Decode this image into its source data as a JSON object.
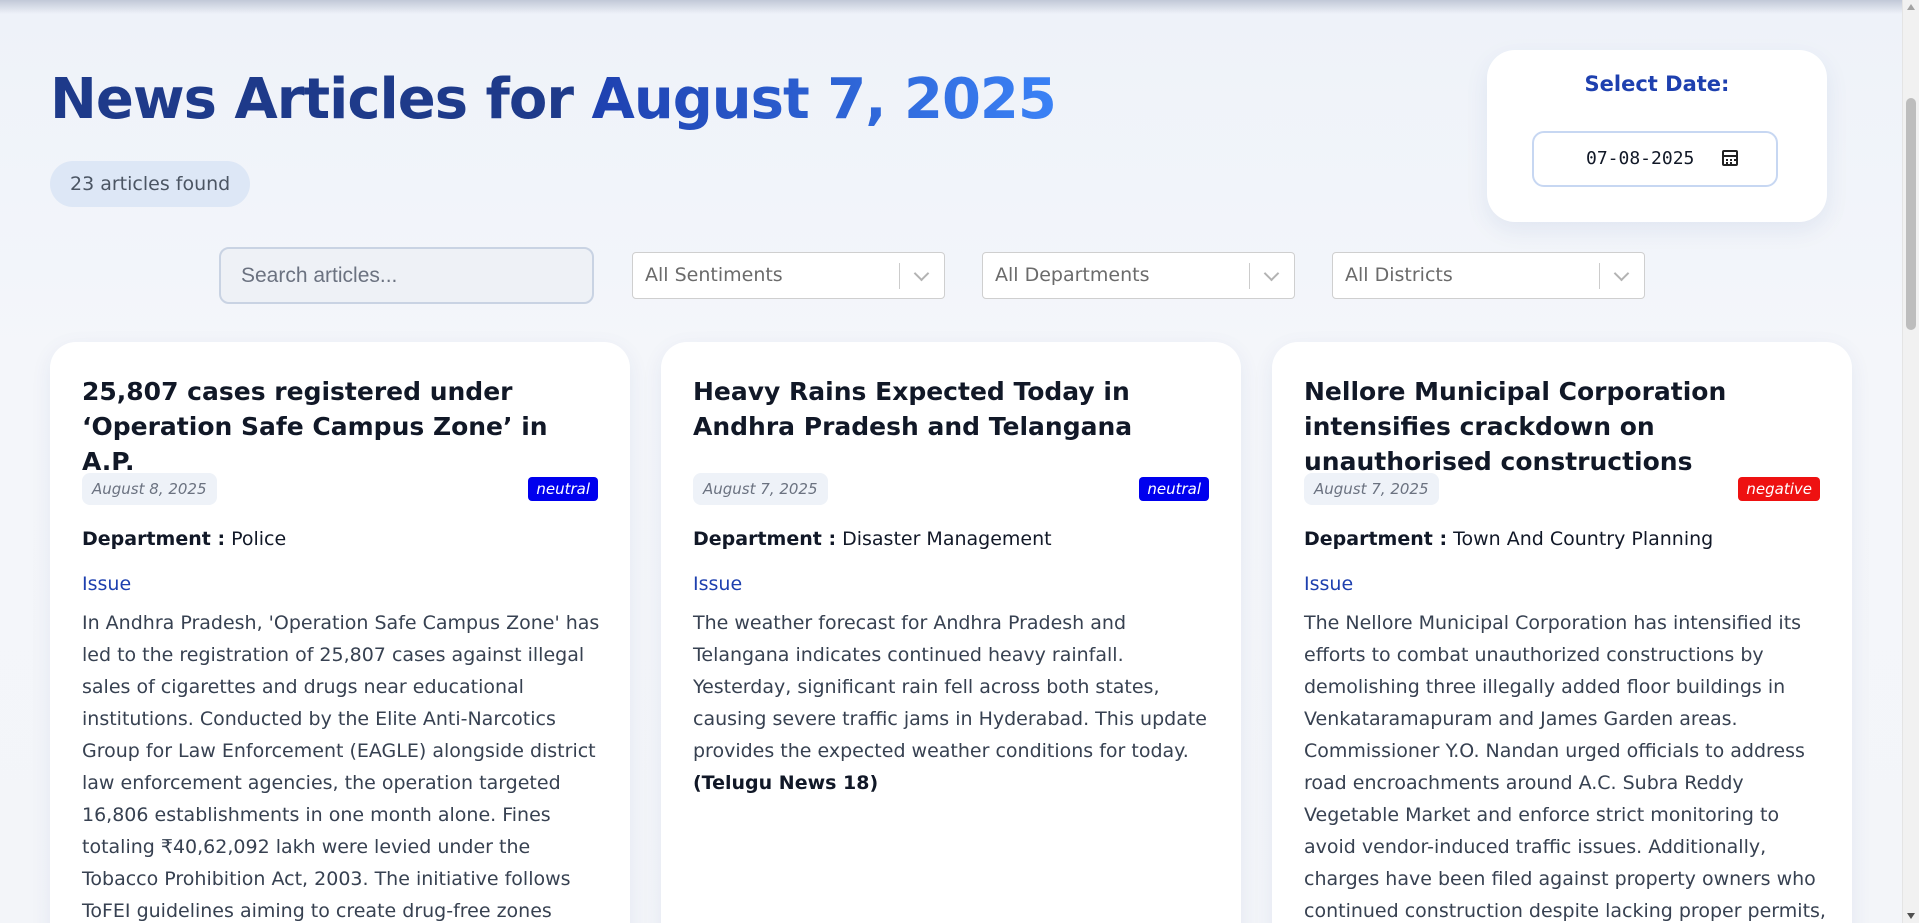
{
  "header": {
    "title_prefix": "News Articles for",
    "title_date": "August 7, 2025",
    "articles_found": "23 articles found"
  },
  "date_picker": {
    "label": "Select Date:",
    "value": "07-08-2025",
    "icon": "calendar-icon"
  },
  "filters": {
    "search_placeholder": "Search articles...",
    "sentiment_value": "All Sentiments",
    "department_value": "All Departments",
    "district_value": "All Districts"
  },
  "colors": {
    "title": "#1e3a8a",
    "accent": "#1e40af",
    "neutral_badge": "#0000ee",
    "negative_badge": "#ee1111"
  },
  "articles": [
    {
      "title": "25,807 cases registered under ‘Operation Safe Campus Zone’ in A.P.",
      "date": "August 8, 2025",
      "sentiment": "neutral",
      "sentiment_color": "#0000ee",
      "department_label": "Department :",
      "department": "Police",
      "issue_heading": "Issue",
      "body": "In Andhra Pradesh, 'Operation Safe Campus Zone' has led to the registration of 25,807 cases against illegal sales of cigarettes and drugs near educational institutions. Conducted by the Elite Anti-Narcotics Group for Law Enforcement (EAGLE) alongside district law enforcement agencies, the operation targeted 16,806 establishments in one month alone. Fines totaling ₹40,62,092 lakh were levied under the Tobacco Prohibition Act, 2003. The initiative follows ToFEI guidelines aiming to create drug-free zones around schools and colleges statewide.",
      "source": ""
    },
    {
      "title": "Heavy Rains Expected Today in Andhra Pradesh and Telangana",
      "date": "August 7, 2025",
      "sentiment": "neutral",
      "sentiment_color": "#0000ee",
      "department_label": "Department :",
      "department": "Disaster Management",
      "issue_heading": "Issue",
      "body": "The weather forecast for Andhra Pradesh and Telangana indicates continued heavy rainfall. Yesterday, significant rain fell across both states, causing severe traffic jams in Hyderabad. This update provides the expected weather conditions for today.",
      "source": "(Telugu News 18)"
    },
    {
      "title": "Nellore Municipal Corporation intensifies crackdown on unauthorised constructions",
      "date": "August 7, 2025",
      "sentiment": "negative",
      "sentiment_color": "#ee1111",
      "department_label": "Department :",
      "department": "Town And Country Planning",
      "issue_heading": "Issue",
      "body": "The Nellore Municipal Corporation has intensified its efforts to combat unauthorized constructions by demolishing three illegally added floor buildings in Venkataramapuram and James Garden areas. Commissioner Y.O. Nandan urged officials to address road encroachments around A.C. Subra Reddy Vegetable Market and enforce strict monitoring to avoid vendor-induced traffic issues. Additionally, charges have been filed against property owners who continued construction despite lacking proper permits, with further actions",
      "source": ""
    }
  ]
}
